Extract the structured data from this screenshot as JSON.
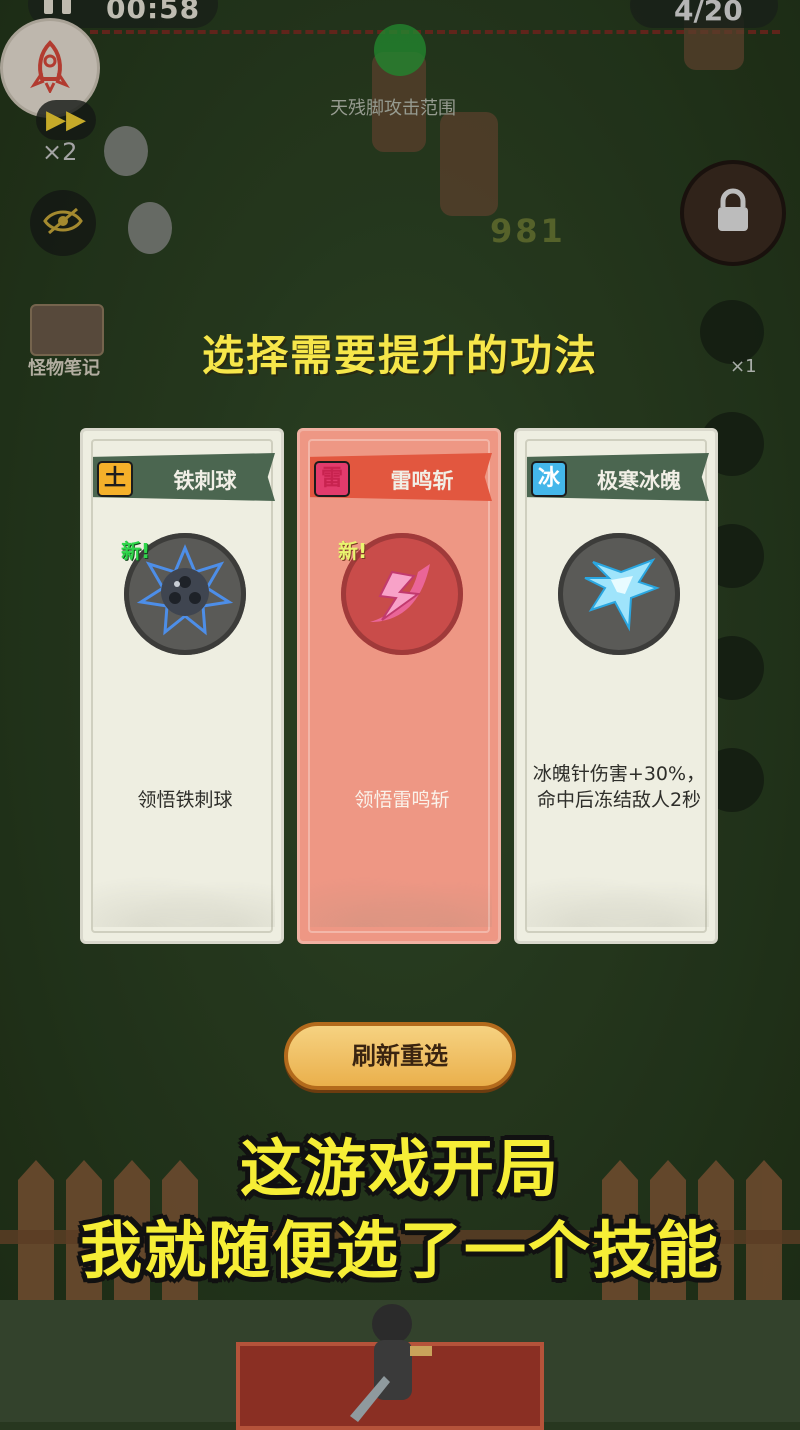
{
  "hud": {
    "timer": "00:58",
    "wave": "4/20",
    "speed_multiplier": "×2",
    "monster_notes_label": "怪物笔记",
    "slot_count": "×1",
    "range_label": "天残脚攻击范围",
    "damage_number": "981"
  },
  "prompt": {
    "title": "选择需要提升的功法"
  },
  "cards": [
    {
      "element_badge": "土",
      "name": "铁刺球",
      "new_tag": "新!",
      "description": "领悟铁刺球",
      "selected": false
    },
    {
      "element_badge": "雷",
      "name": "雷鸣斩",
      "new_tag": "新!",
      "description": "领悟雷鸣斩",
      "selected": true
    },
    {
      "element_badge": "冰",
      "name": "极寒冰魄",
      "new_tag": "",
      "description": "冰魄针伤害+30%，命中后冻结敌人2秒",
      "selected": false
    }
  ],
  "card_icons": [
    "spiked-ball-icon",
    "thunder-slash-icon",
    "ice-shard-icon"
  ],
  "buttons": {
    "refresh": "刷新重选"
  },
  "subtitle": {
    "line1": "这游戏开局",
    "line2": "我就随便选了一个技能"
  },
  "colors": {
    "headline": "#f6e64a",
    "subtitle": "#f6ee36",
    "selected_card": "#ee9784",
    "banner": "#4b6650"
  }
}
